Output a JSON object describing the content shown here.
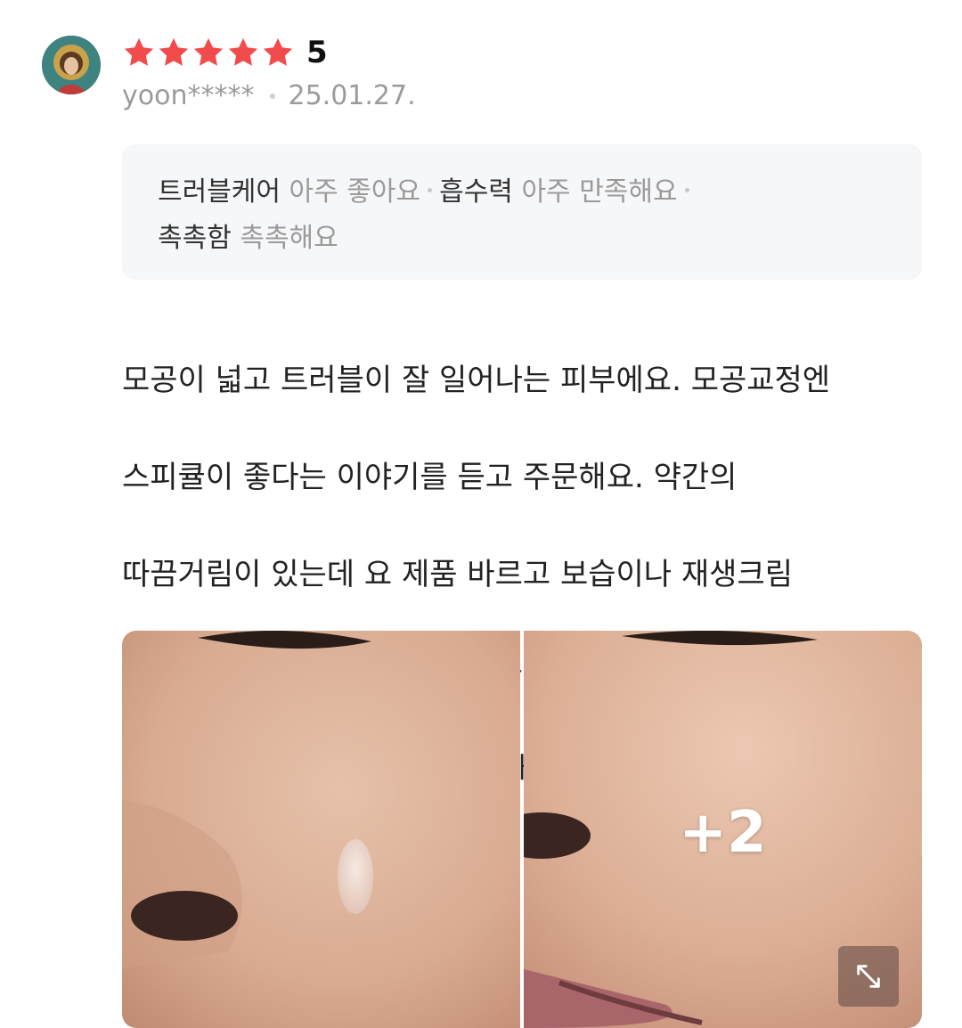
{
  "review": {
    "avatar_icon": "user-avatar",
    "rating": {
      "stars_filled": 5,
      "stars_total": 5,
      "value": "5",
      "star_color": "#f24b4b"
    },
    "author": "yoon*****",
    "date": "25.01.27.",
    "survey": [
      {
        "key": "트러블케어",
        "value": "아주 좋아요"
      },
      {
        "key": "흡수력",
        "value": "아주 만족해요"
      },
      {
        "key": "촉촉함",
        "value": "촉촉해요"
      }
    ],
    "body_lines": [
      "모공이 넓고 트러블이 잘 일어나는 피부에요. 모공교정엔",
      "스피큘이 좋다는 이야기를 듣고 주문해요. 약간의",
      "따끔거림이 있는데 요 제품 바르고 보습이나 재생크림",
      "듬뿍 발라주면 영양분이 정말 쏙쏙 흡수되면서 피부",
      "안색이 확 올라오네요. 넘 만족해요. 꾸준히",
      "사용해보려고요!"
    ],
    "photos": {
      "more_count": "+2",
      "expand_icon": "expand-arrows-icon"
    }
  }
}
